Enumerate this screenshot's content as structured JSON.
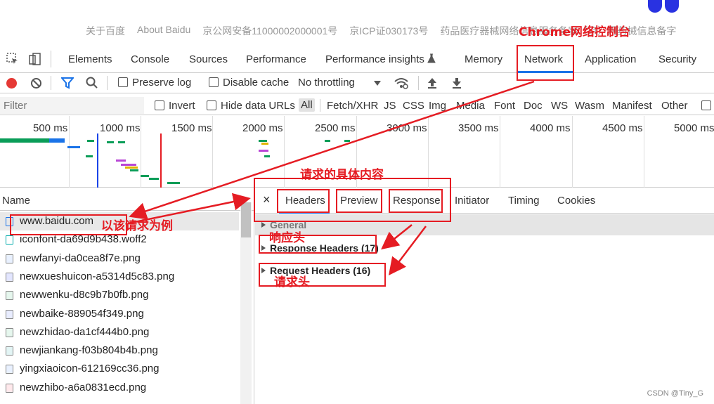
{
  "baidu_footer": {
    "links": [
      "关于百度",
      "About Baidu",
      "京公网安备11000002000001号",
      "京ICP证030173号",
      "药品医疗器械网络信息服务备案（京）网药械信息备字"
    ]
  },
  "devtools_tabs": [
    "Elements",
    "Console",
    "Sources",
    "Performance",
    "Performance insights",
    "Memory",
    "Network",
    "Application",
    "Security"
  ],
  "toolbar": {
    "preserve_log": "Preserve log",
    "disable_cache": "Disable cache",
    "throttling": "No throttling"
  },
  "filterbar": {
    "placeholder": "Filter",
    "invert": "Invert",
    "hide_data_urls": "Hide data URLs",
    "types": [
      "All",
      "Fetch/XHR",
      "JS",
      "CSS",
      "Img",
      "Media",
      "Font",
      "Doc",
      "WS",
      "Wasm",
      "Manifest",
      "Other"
    ]
  },
  "timeline": {
    "ticks": [
      "500 ms",
      "1000 ms",
      "1500 ms",
      "2000 ms",
      "2500 ms",
      "3000 ms",
      "3500 ms",
      "4000 ms",
      "4500 ms",
      "5000 ms"
    ]
  },
  "request_list": {
    "header": "Name",
    "items": [
      "www.baidu.com",
      "iconfont-da69d9b438.woff2",
      "newfanyi-da0cea8f7e.png",
      "newxueshuicon-a5314d5c83.png",
      "newwenku-d8c9b7b0fb.png",
      "newbaike-889054f349.png",
      "newzhidao-da1cf444b0.png",
      "newjiankang-f03b804b4b.png",
      "yingxiaoicon-612169cc36.png",
      "newzhibo-a6a0831ecd.png"
    ]
  },
  "detail": {
    "close": "×",
    "tabs": [
      "Headers",
      "Preview",
      "Response",
      "Initiator",
      "Timing",
      "Cookies"
    ],
    "general": "General",
    "response_headers": "Response Headers (17)",
    "request_headers": "Request Headers (16)"
  },
  "annotations": {
    "chrome_console": "Chrome网络控制台",
    "request_content": "请求的具体内容",
    "example_request": "以该请求为例",
    "response_header": "响应头",
    "request_header": "请求头"
  },
  "watermark": "CSDN @Tiny_G",
  "colors": {
    "annotation": "#e51c23",
    "record": "#e53935",
    "filter_icon": "#1a73e8"
  }
}
